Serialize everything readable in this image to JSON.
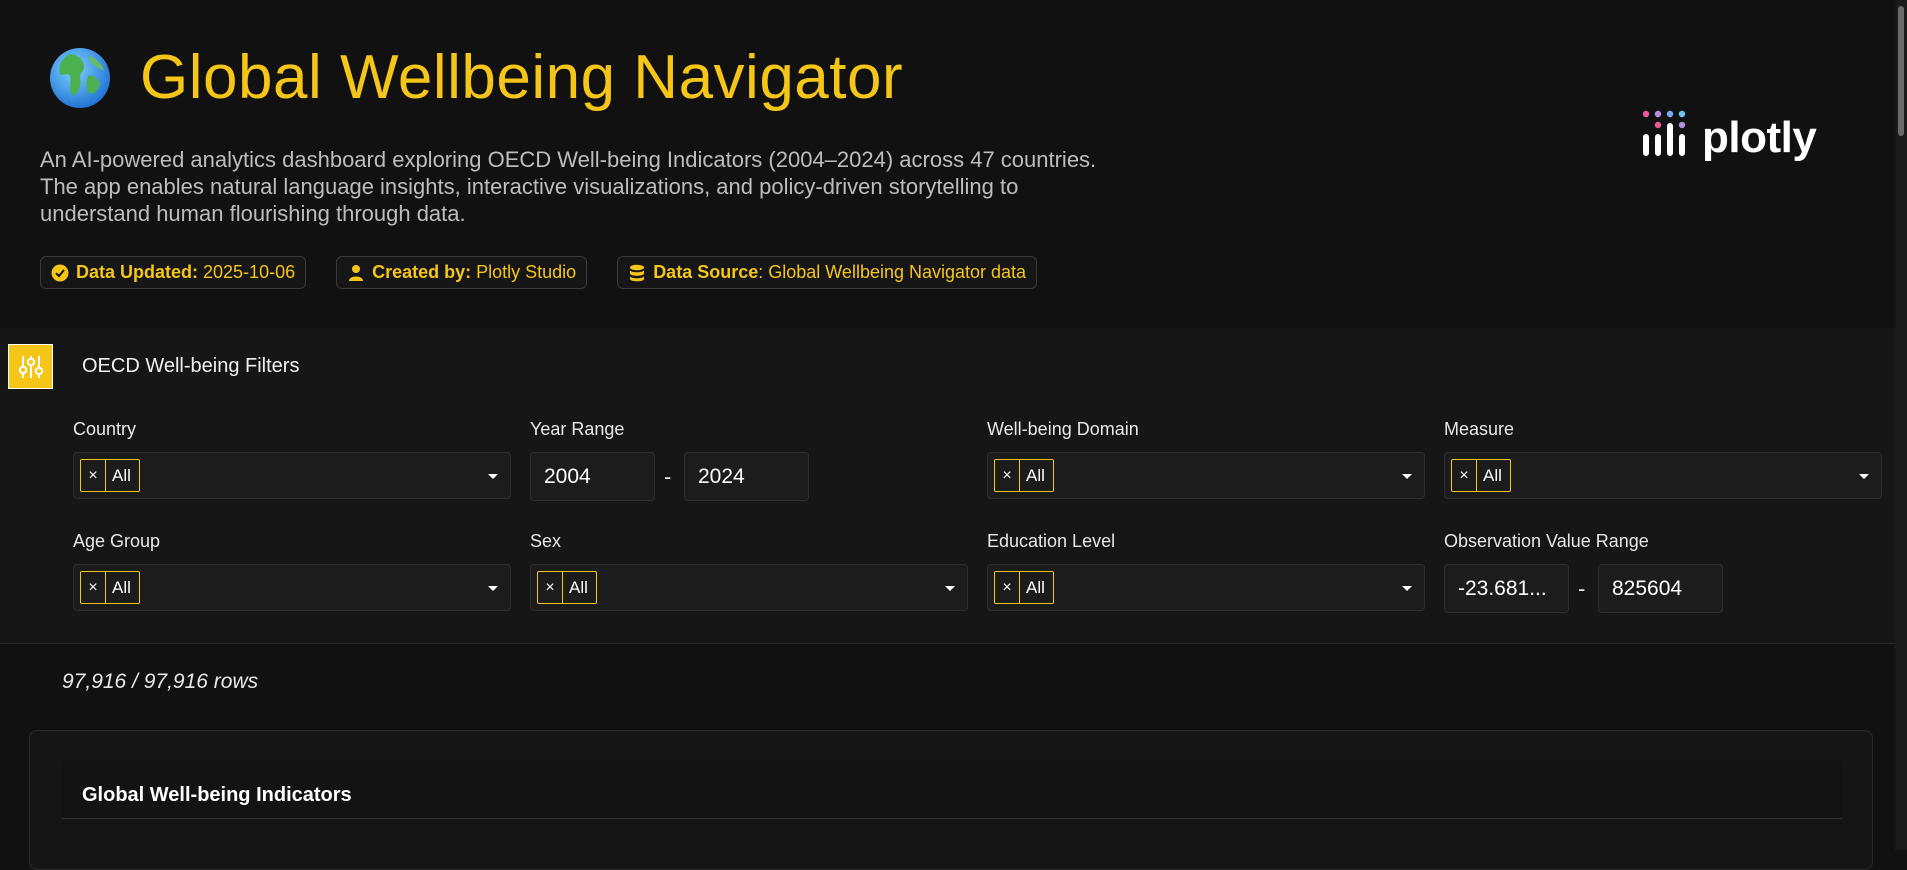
{
  "header": {
    "title": "Global Wellbeing Navigator",
    "description": "An AI-powered analytics dashboard exploring OECD Well-being Indicators (2004–2024) across 47 countries. The app enables natural language insights, interactive visualizations, and policy-driven storytelling to understand human flourishing through data.",
    "globe_icon": "globe-icon",
    "logo_text": "plotly",
    "badges": [
      {
        "label": "Data Updated:",
        "value": "2025-10-06",
        "icon": "check-circle-icon"
      },
      {
        "label": "Created by:",
        "value": "Plotly Studio",
        "icon": "user-icon"
      },
      {
        "label": "Data Source",
        "value": ": Global Wellbeing Navigator data",
        "icon": "database-icon"
      }
    ]
  },
  "filters": {
    "title": "OECD Well-being Filters",
    "icon": "sliders-icon",
    "country": {
      "label": "Country",
      "selected": "All"
    },
    "year_range": {
      "label": "Year Range",
      "from": "2004",
      "to": "2024",
      "separator": "-"
    },
    "domain": {
      "label": "Well-being Domain",
      "selected": "All"
    },
    "measure": {
      "label": "Measure",
      "selected": "All"
    },
    "age_group": {
      "label": "Age Group",
      "selected": "All"
    },
    "sex": {
      "label": "Sex",
      "selected": "All"
    },
    "education": {
      "label": "Education Level",
      "selected": "All"
    },
    "obs_range": {
      "label": "Observation Value Range",
      "from": "-23.681...",
      "to": "825604",
      "separator": "-"
    },
    "chip_remove": "×"
  },
  "rows": {
    "text": "97,916 / 97,916 rows"
  },
  "card": {
    "title": "Global Well-being Indicators"
  },
  "colors": {
    "accent": "#f5c518",
    "background": "#111111",
    "panel": "#161616"
  }
}
